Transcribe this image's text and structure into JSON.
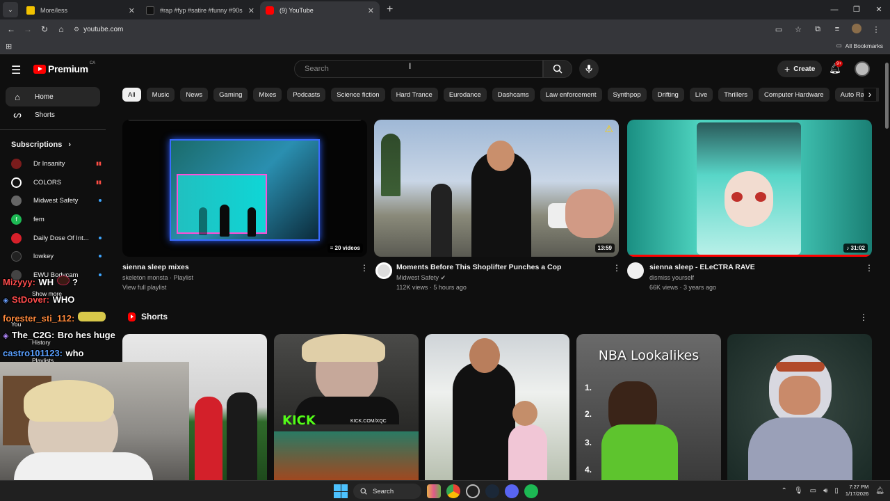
{
  "browser": {
    "tabs": [
      {
        "title": "More/less",
        "active": false
      },
      {
        "title": "#rap #fyp #satire #funny #90s",
        "active": false
      },
      {
        "title": "(9) YouTube",
        "active": true
      }
    ],
    "address": "youtube.com",
    "bookmarks_label": "All Bookmarks"
  },
  "yt": {
    "logo_text": "Premium",
    "country": "CA",
    "search_placeholder": "Search",
    "create_label": "Create",
    "notif_count": "9+"
  },
  "sidebar": {
    "items": [
      {
        "label": "Home",
        "icon": "home-icon"
      },
      {
        "label": "Shorts",
        "icon": "shorts-icon"
      }
    ],
    "subs_heading": "Subscriptions",
    "subs": [
      {
        "name": "Dr Insanity",
        "status": "live",
        "color": "#7a1c1c"
      },
      {
        "name": "COLORS",
        "status": "live",
        "color": "#111111"
      },
      {
        "name": "Midwest Safety",
        "status": "dot",
        "color": "#666666"
      },
      {
        "name": "fem",
        "status": "none",
        "color": "#1db954"
      },
      {
        "name": "Daily Dose Of Int...",
        "status": "dot",
        "color": "#d6202a"
      },
      {
        "name": "lowkey",
        "status": "dot",
        "color": "#222222"
      },
      {
        "name": "EWU Bodycam",
        "status": "dot",
        "color": "#444444"
      }
    ],
    "show_more": "Show more",
    "you_label": "You",
    "history_label": "History",
    "playlists_label": "Playlists"
  },
  "chips": [
    "All",
    "Music",
    "News",
    "Gaming",
    "Mixes",
    "Podcasts",
    "Science fiction",
    "Hard Trance",
    "Eurodance",
    "Dashcams",
    "Law enforcement",
    "Synthpop",
    "Drifting",
    "Live",
    "Thrillers",
    "Computer Hardware",
    "Auto Racing"
  ],
  "videos": [
    {
      "title": "sienna sleep mixes",
      "channel": "skeleton monsta · Playlist",
      "stats": "View full playlist",
      "badge": "20 videos"
    },
    {
      "title": "Moments Before This Shoplifter Punches a Cop",
      "channel": "Midwest Safety",
      "stats": "112K views · 5 hours ago",
      "badge": "13:59"
    },
    {
      "title": "sienna sleep - ELeCTRA RAVE",
      "channel": "dismiss yourself",
      "stats": "66K views · 3 years ago",
      "badge": "31:02"
    }
  ],
  "shorts": {
    "heading": "Shorts",
    "overlay_kick": "KICK",
    "overlay_kick_url": "KICK.COM/XQC",
    "overlay_nba": "NBA Lookalikes",
    "nba_numbers": [
      "1.",
      "2.",
      "3.",
      "4."
    ]
  },
  "chat": [
    {
      "user": "Mizyyy:",
      "msg": "WH",
      "extra": "?",
      "color": "#ff4d4d"
    },
    {
      "user": "StDover:",
      "msg": "WHO",
      "color": "#ff4d4d"
    },
    {
      "user": "forester_sti_112:",
      "msg": "",
      "color": "#ff8a3d"
    },
    {
      "user": "The_C2G:",
      "msg": "Bro hes huge",
      "color": "#ffffff"
    },
    {
      "user": "castro101123:",
      "msg": "who",
      "color": "#5aa0ff"
    }
  ],
  "taskbar": {
    "search_label": "Search",
    "time": "7:27 PM",
    "date": "1/17/2026"
  }
}
